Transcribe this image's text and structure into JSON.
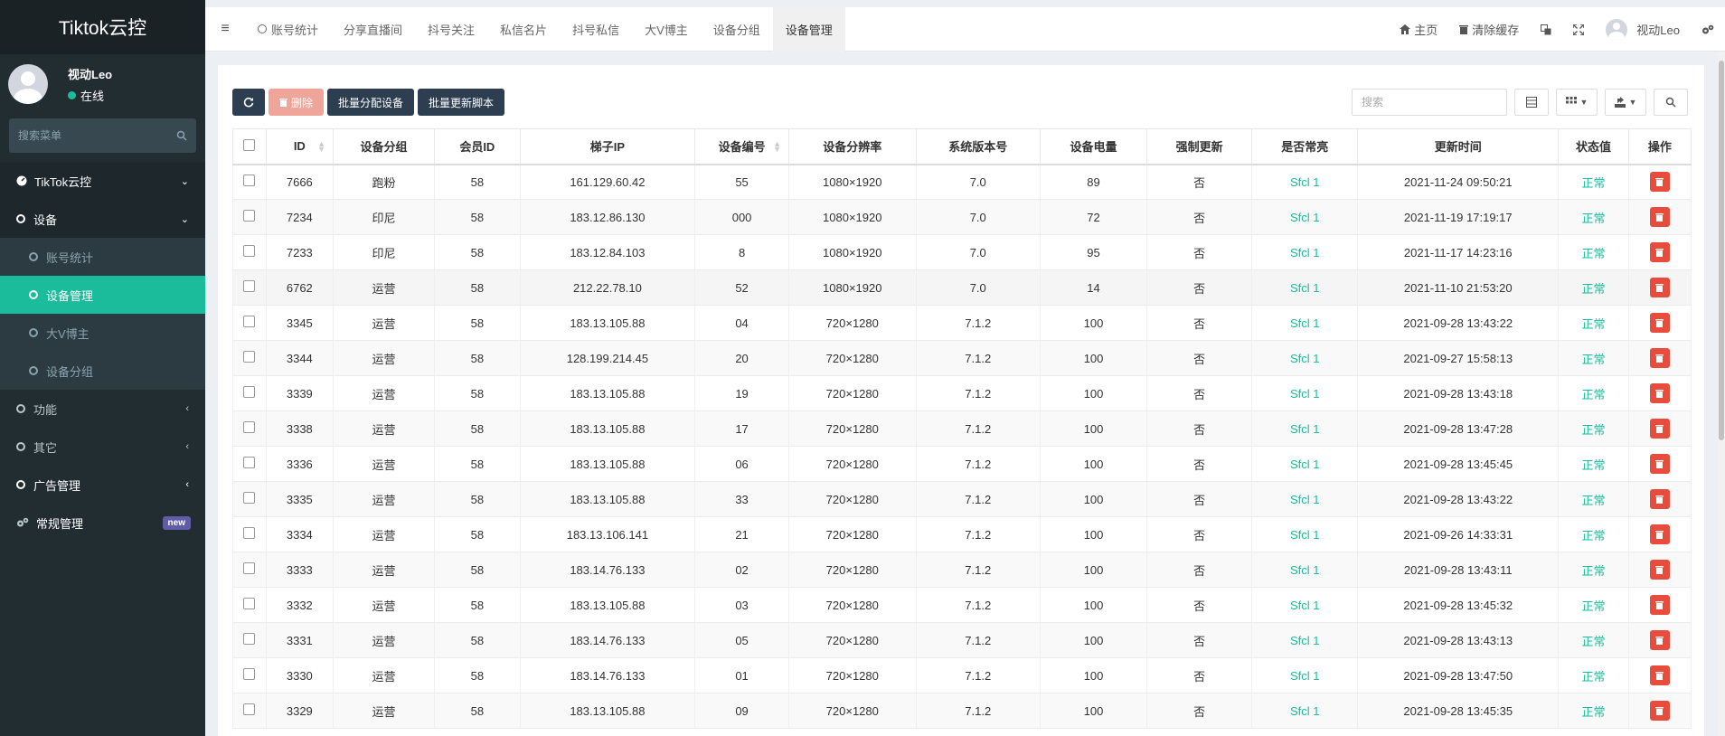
{
  "app": {
    "title": "Tiktok云控"
  },
  "user": {
    "name": "视动Leo",
    "status": "在线"
  },
  "sidebar": {
    "search_placeholder": "搜索菜单",
    "items": [
      {
        "label": "TikTok云控"
      },
      {
        "label": "设备"
      },
      {
        "label": "账号统计"
      },
      {
        "label": "设备管理"
      },
      {
        "label": "大V博主"
      },
      {
        "label": "设备分组"
      },
      {
        "label": "功能"
      },
      {
        "label": "其它"
      },
      {
        "label": "广告管理"
      },
      {
        "label": "常规管理",
        "badge": "new"
      }
    ]
  },
  "topbar": {
    "tabs": [
      "账号统计",
      "分享直播间",
      "抖号关注",
      "私信名片",
      "抖号私信",
      "大V博主",
      "设备分组",
      "设备管理"
    ],
    "home": "主页",
    "clear_cache": "清除缓存",
    "username": "视动Leo"
  },
  "toolbar": {
    "delete": "删除",
    "batch_assign": "批量分配设备",
    "batch_update": "批量更新脚本",
    "search_placeholder": "搜索"
  },
  "table": {
    "headers": [
      "ID",
      "设备分组",
      "会员ID",
      "梯子IP",
      "设备编号",
      "设备分辨率",
      "系统版本号",
      "设备电量",
      "强制更新",
      "是否常亮",
      "更新时间",
      "状态值",
      "操作"
    ],
    "rows": [
      [
        "7666",
        "跑粉",
        "58",
        "161.129.60.42",
        "55",
        "1080×1920",
        "7.0",
        "89",
        "否",
        "Sfcl 1",
        "2021-11-24 09:50:21",
        "正常"
      ],
      [
        "7234",
        "印尼",
        "58",
        "183.12.86.130",
        "000",
        "1080×1920",
        "7.0",
        "72",
        "否",
        "Sfcl 1",
        "2021-11-19 17:19:17",
        "正常"
      ],
      [
        "7233",
        "印尼",
        "58",
        "183.12.84.103",
        "8",
        "1080×1920",
        "7.0",
        "95",
        "否",
        "Sfcl 1",
        "2021-11-17 14:23:16",
        "正常"
      ],
      [
        "6762",
        "运营",
        "58",
        "212.22.78.10",
        "52",
        "1080×1920",
        "7.0",
        "14",
        "否",
        "Sfcl 1",
        "2021-11-10 21:53:20",
        "正常"
      ],
      [
        "3345",
        "运营",
        "58",
        "183.13.105.88",
        "04",
        "720×1280",
        "7.1.2",
        "100",
        "否",
        "Sfcl 1",
        "2021-09-28 13:43:22",
        "正常"
      ],
      [
        "3344",
        "运营",
        "58",
        "128.199.214.45",
        "20",
        "720×1280",
        "7.1.2",
        "100",
        "否",
        "Sfcl 1",
        "2021-09-27 15:58:13",
        "正常"
      ],
      [
        "3339",
        "运营",
        "58",
        "183.13.105.88",
        "19",
        "720×1280",
        "7.1.2",
        "100",
        "否",
        "Sfcl 1",
        "2021-09-28 13:43:18",
        "正常"
      ],
      [
        "3338",
        "运营",
        "58",
        "183.13.105.88",
        "17",
        "720×1280",
        "7.1.2",
        "100",
        "否",
        "Sfcl 1",
        "2021-09-28 13:47:28",
        "正常"
      ],
      [
        "3336",
        "运营",
        "58",
        "183.13.105.88",
        "06",
        "720×1280",
        "7.1.2",
        "100",
        "否",
        "Sfcl 1",
        "2021-09-28 13:45:45",
        "正常"
      ],
      [
        "3335",
        "运营",
        "58",
        "183.13.105.88",
        "33",
        "720×1280",
        "7.1.2",
        "100",
        "否",
        "Sfcl 1",
        "2021-09-28 13:43:22",
        "正常"
      ],
      [
        "3334",
        "运营",
        "58",
        "183.13.106.141",
        "21",
        "720×1280",
        "7.1.2",
        "100",
        "否",
        "Sfcl 1",
        "2021-09-26 14:33:31",
        "正常"
      ],
      [
        "3333",
        "运营",
        "58",
        "183.14.76.133",
        "02",
        "720×1280",
        "7.1.2",
        "100",
        "否",
        "Sfcl 1",
        "2021-09-28 13:43:11",
        "正常"
      ],
      [
        "3332",
        "运营",
        "58",
        "183.13.105.88",
        "03",
        "720×1280",
        "7.1.2",
        "100",
        "否",
        "Sfcl 1",
        "2021-09-28 13:45:32",
        "正常"
      ],
      [
        "3331",
        "运营",
        "58",
        "183.14.76.133",
        "05",
        "720×1280",
        "7.1.2",
        "100",
        "否",
        "Sfcl 1",
        "2021-09-28 13:43:13",
        "正常"
      ],
      [
        "3330",
        "运营",
        "58",
        "183.14.76.133",
        "01",
        "720×1280",
        "7.1.2",
        "100",
        "否",
        "Sfcl 1",
        "2021-09-28 13:47:50",
        "正常"
      ],
      [
        "3329",
        "运营",
        "58",
        "183.13.105.88",
        "09",
        "720×1280",
        "7.1.2",
        "100",
        "否",
        "Sfcl 1",
        "2021-09-28 13:45:35",
        "正常"
      ]
    ]
  },
  "colors": {
    "accent": "#1abc9c",
    "sidebar": "#222d32",
    "danger": "#e74c3c",
    "dark_button": "#2c3e50"
  }
}
